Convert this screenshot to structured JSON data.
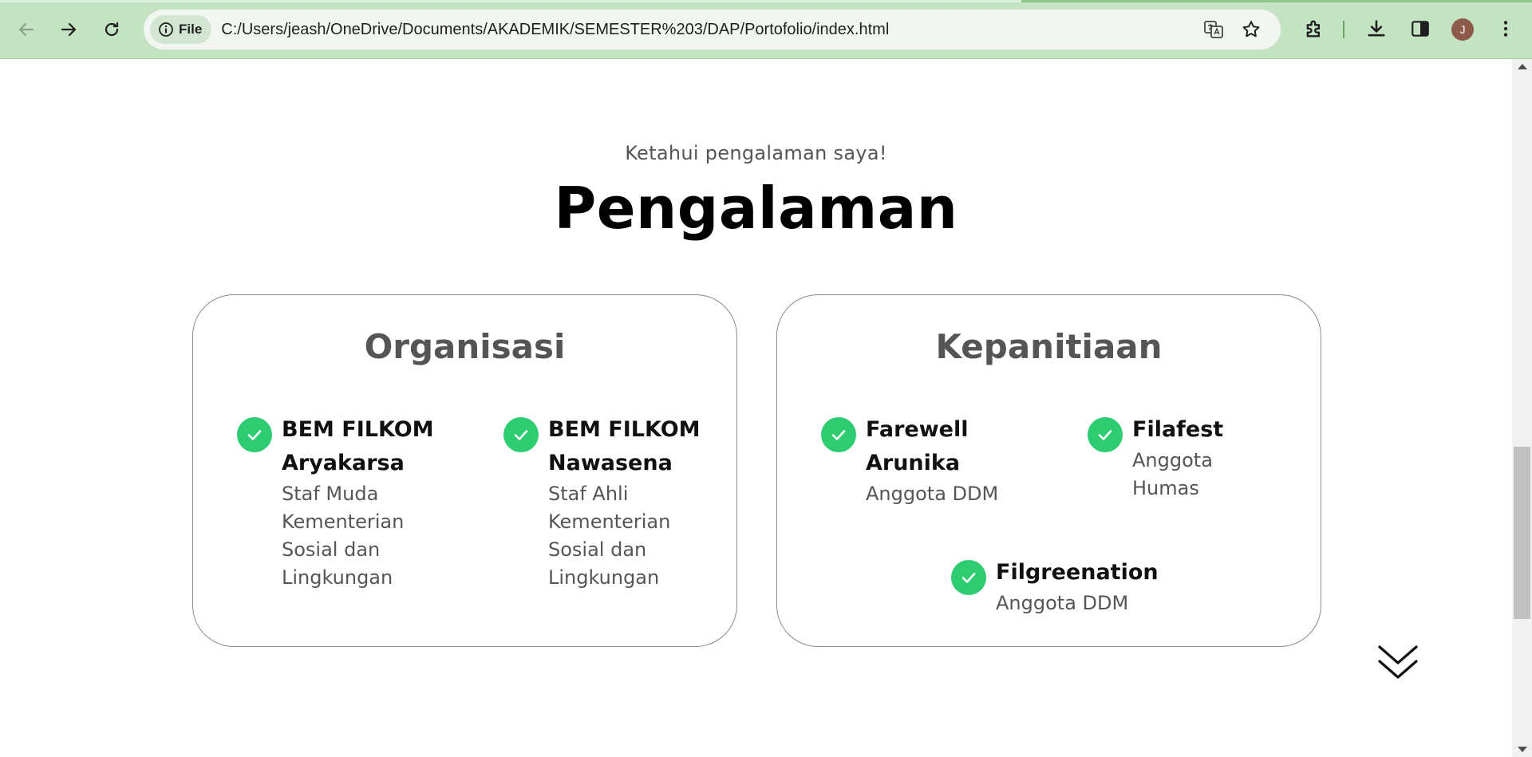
{
  "browser": {
    "site_chip_label": "File",
    "url": "C:/Users/jeash/OneDrive/Documents/AKADEMIK/SEMESTER%203/DAP/Portofolio/index.html",
    "avatar_initial": "J"
  },
  "section": {
    "eyebrow": "Ketahui pengalaman saya!",
    "title": "Pengalaman"
  },
  "organisasi": {
    "title": "Organisasi",
    "items": [
      {
        "name_line1": "BEM FILKOM",
        "name_line2": "Aryakarsa",
        "role_lines": [
          "Staf Muda",
          "Kementerian",
          "Sosial dan",
          "Lingkungan"
        ]
      },
      {
        "name_line1": "BEM FILKOM",
        "name_line2": "Nawasena",
        "role_lines": [
          "Staf Ahli",
          "Kementerian",
          "Sosial dan",
          "Lingkungan"
        ]
      }
    ]
  },
  "kepanitiaan": {
    "title": "Kepanitiaan",
    "items": [
      {
        "name_line1": "Farewell",
        "name_line2": "Arunika",
        "role_lines": [
          "Anggota DDM"
        ]
      },
      {
        "name_line1": "Filafest",
        "role_lines": [
          "Anggota",
          "Humas"
        ]
      },
      {
        "name_line1": "Filgreenation",
        "role_lines": [
          "Anggota DDM"
        ]
      }
    ]
  },
  "colors": {
    "toolbar": "#c4e3c2",
    "check": "#2ecc71",
    "heading_gray": "#555555"
  }
}
